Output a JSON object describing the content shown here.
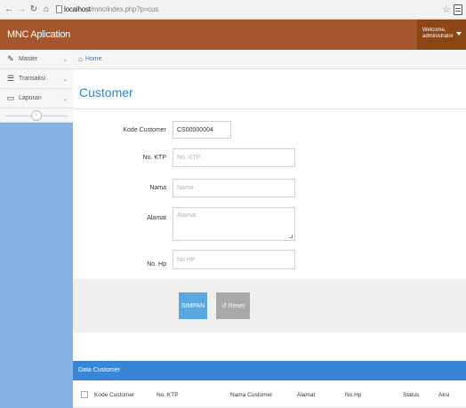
{
  "browser": {
    "url_host": "localhost",
    "url_path": "/mnc/index.php?p=cus"
  },
  "app": {
    "brand": "MNC Aplication",
    "user_line1": "Welcome,",
    "user_line2": "administrator"
  },
  "sidebar": {
    "items": [
      {
        "label": "Master",
        "icon": "edit-icon"
      },
      {
        "label": "Transaksi",
        "icon": "list-icon"
      },
      {
        "label": "Laporan",
        "icon": "desktop-icon"
      }
    ]
  },
  "breadcrumb": {
    "home": "Home"
  },
  "page": {
    "title": "Customer"
  },
  "form": {
    "kode_label": "Kode Customer",
    "kode_value": "CS00000004",
    "ktp_label": "No. KTP",
    "ktp_placeholder": "No. KTP",
    "nama_label": "Nama",
    "nama_placeholder": "Nama",
    "alamat_label": "Alamat",
    "alamat_placeholder": "Alamat",
    "hp_label": "No. Hp",
    "hp_placeholder": "No.HP",
    "save_label": "SIMPAN",
    "reset_label": "Reset"
  },
  "table": {
    "title": "Data Customer",
    "columns": [
      "Kode Customer",
      "No. KTP",
      "Nama Customer",
      "Alamat",
      "No.Hp",
      "Status",
      "Aksi"
    ]
  },
  "colors": {
    "header": "#a4562c",
    "sidebar": "#86b2e4",
    "primary": "#3a86d6",
    "title": "#2f86c7"
  }
}
